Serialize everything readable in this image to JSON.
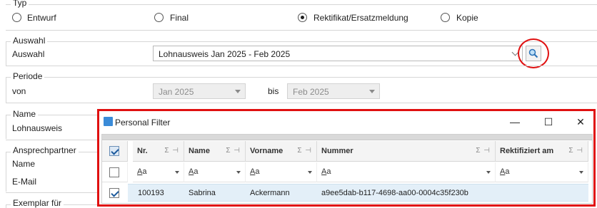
{
  "typ": {
    "legend": "Typ",
    "options": [
      {
        "label": "Entwurf",
        "checked": false
      },
      {
        "label": "Final",
        "checked": false
      },
      {
        "label": "Rektifikat/Ersatzmeldung",
        "checked": true
      },
      {
        "label": "Kopie",
        "checked": false
      }
    ]
  },
  "auswahl": {
    "legend": "Auswahl",
    "label": "Auswahl",
    "value": "Lohnausweis Jan 2025 - Feb 2025"
  },
  "periode": {
    "legend": "Periode",
    "von_label": "von",
    "von_value": "Jan 2025",
    "bis_label": "bis",
    "bis_value": "Feb 2025"
  },
  "name_group": {
    "legend": "Name",
    "label": "Lohnausweis"
  },
  "ansprechpartner": {
    "legend": "Ansprechpartner",
    "name_label": "Name",
    "email_label": "E-Mail"
  },
  "exemplar": {
    "legend": "Exemplar für"
  },
  "dialog": {
    "title": "Personal Filter",
    "minimize": "—",
    "maximize": "☐",
    "close": "✕",
    "columns": [
      {
        "label": "Nr.",
        "tools": "Σ ⊣"
      },
      {
        "label": "Name",
        "tools": "Σ ⊣"
      },
      {
        "label": "Vorname",
        "tools": "Σ ⊣"
      },
      {
        "label": "Nummer",
        "tools": "Σ ⊣"
      },
      {
        "label": "Rektifiziert am",
        "tools": "Σ ⊣"
      }
    ],
    "filter_token": "Aa",
    "rows": [
      {
        "selected": true,
        "nr": "100193",
        "name": "Sabrina",
        "vorname": "Ackermann",
        "nummer": "a9ee5dab-b117-4698-aa00-0004c35f230b",
        "rektifiziert": ""
      }
    ]
  },
  "colors": {
    "accent_red": "#e01010",
    "row_selected": "#e3eff8",
    "check_blue": "#1c5a9c"
  }
}
